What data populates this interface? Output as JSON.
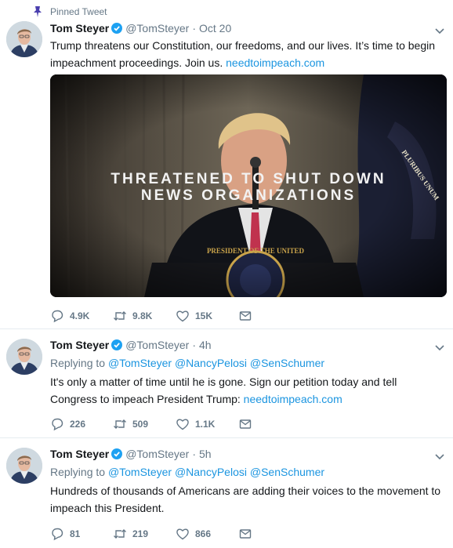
{
  "tweets": [
    {
      "pinned_label": "Pinned Tweet",
      "name": "Tom Steyer",
      "handle": "@TomSteyer",
      "dot": "·",
      "time": "Oct 20",
      "text_before": "Trump threatens our Constitution, our freedoms, and our lives. It’s time to begin impeachment proceedings. Join us. ",
      "link": "needtoimpeach.com",
      "media": {
        "caption_line1": "THREATENED TO SHUT DOWN",
        "caption_line2": "NEWS ORGANIZATIONS",
        "seal_text": "PRESIDENT OF THE UNITED",
        "flag_text": "PLURIBUS UNUM"
      },
      "replies": "4.9K",
      "retweets": "9.8K",
      "likes": "15K"
    },
    {
      "name": "Tom Steyer",
      "handle": "@TomSteyer",
      "dot": "·",
      "time": "4h",
      "replying_label": "Replying to",
      "mentions": [
        "@TomSteyer",
        "@NancyPelosi",
        "@SenSchumer"
      ],
      "text_before": "It's only a matter of time until he is gone. Sign our petition today and tell Congress to impeach President Trump: ",
      "link": "needtoimpeach.com",
      "replies": "226",
      "retweets": "509",
      "likes": "1.1K"
    },
    {
      "name": "Tom Steyer",
      "handle": "@TomSteyer",
      "dot": "·",
      "time": "5h",
      "replying_label": "Replying to",
      "mentions": [
        "@TomSteyer",
        "@NancyPelosi",
        "@SenSchumer"
      ],
      "text_before": "Hundreds of thousands of Americans are adding their voices to the movement to impeach this President.",
      "replies": "81",
      "retweets": "219",
      "likes": "866"
    }
  ],
  "colors": {
    "link": "#1b95e0",
    "muted": "#657786",
    "pin": "#4a3fae",
    "verified": "#1da1f2"
  }
}
